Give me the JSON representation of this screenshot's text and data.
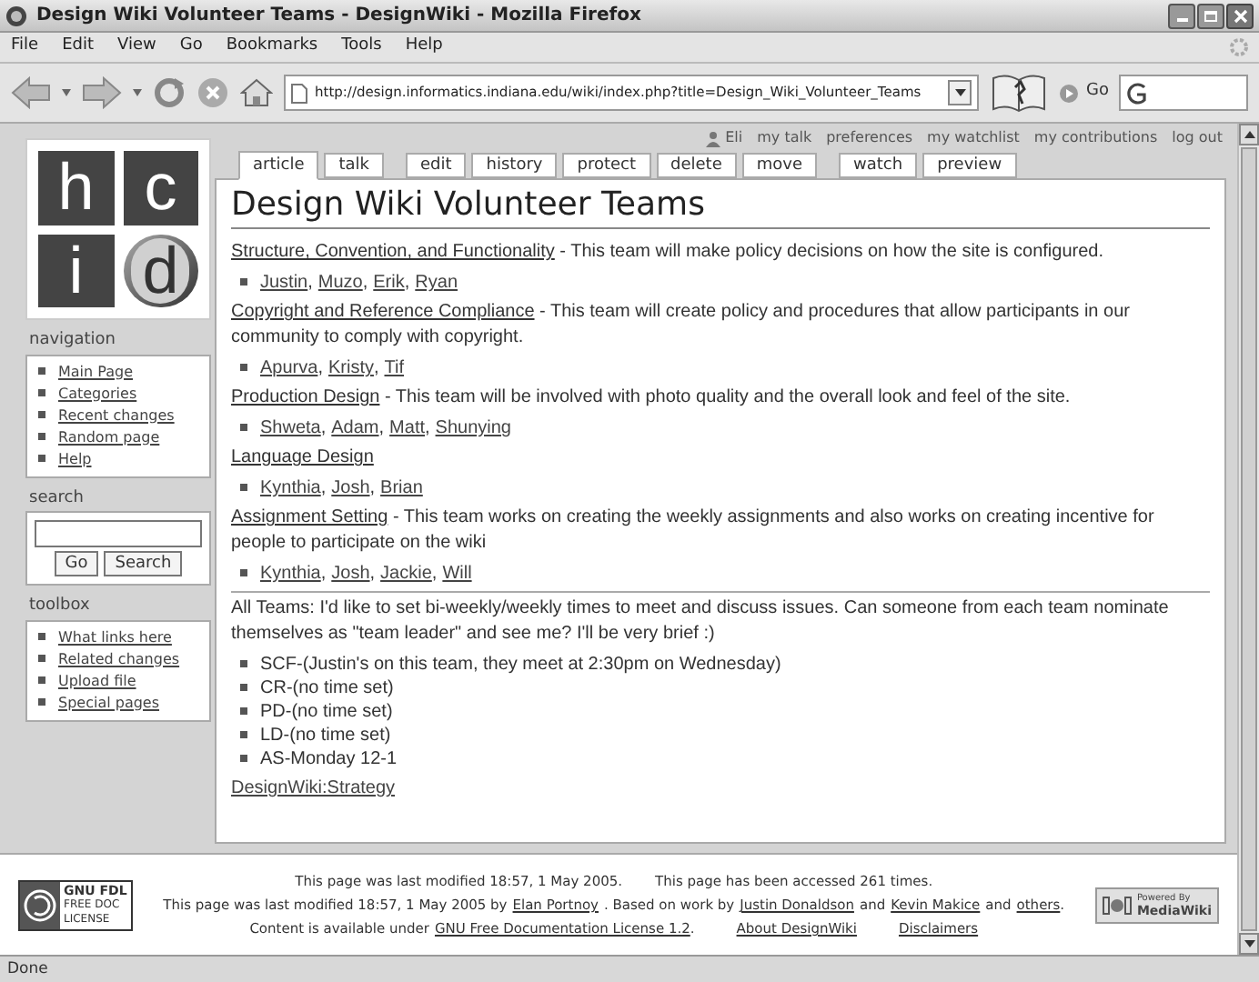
{
  "window": {
    "title": "Design Wiki Volunteer Teams - DesignWiki - Mozilla Firefox"
  },
  "menu": [
    "File",
    "Edit",
    "View",
    "Go",
    "Bookmarks",
    "Tools",
    "Help"
  ],
  "toolbar": {
    "url": "http://design.informatics.indiana.edu/wiki/index.php?title=Design_Wiki_Volunteer_Teams",
    "go_label": "Go"
  },
  "personal": {
    "user": "Eli",
    "links": [
      "my talk",
      "preferences",
      "my watchlist",
      "my contributions",
      "log out"
    ]
  },
  "tab_groups": [
    [
      {
        "label": "article",
        "selected": true
      },
      {
        "label": "talk",
        "selected": false
      }
    ],
    [
      {
        "label": "edit",
        "selected": false
      },
      {
        "label": "history",
        "selected": false
      },
      {
        "label": "protect",
        "selected": false
      },
      {
        "label": "delete",
        "selected": false
      },
      {
        "label": "move",
        "selected": false
      }
    ],
    [
      {
        "label": "watch",
        "selected": false
      },
      {
        "label": "preview",
        "selected": false
      }
    ]
  ],
  "logo": {
    "letters": [
      "h",
      "c",
      "i",
      "d"
    ]
  },
  "sidebar": {
    "navigation": {
      "label": "navigation",
      "items": [
        "Main Page",
        "Categories",
        "Recent changes",
        "Random page",
        "Help"
      ]
    },
    "search": {
      "label": "search",
      "buttons": [
        "Go",
        "Search"
      ]
    },
    "toolbox": {
      "label": "toolbox",
      "items": [
        "What links here",
        "Related changes",
        "Upload file",
        "Special pages"
      ]
    }
  },
  "heading": "Design Wiki Volunteer Teams",
  "member_separator": ",",
  "sections": [
    {
      "title": "Structure, Convention, and Functionality",
      "description": "- This team will make policy decisions on how the site is configured.",
      "members": [
        "Justin",
        "Muzo",
        "Erik",
        "Ryan"
      ]
    },
    {
      "title": "Copyright and Reference Compliance",
      "description": "- This team will create policy and procedures that allow participants in our community to comply with copyright.",
      "members": [
        "Apurva",
        "Kristy",
        "Tif"
      ]
    },
    {
      "title": "Production Design",
      "description": "- This team will be involved with photo quality and the overall look and feel of the site.",
      "members": [
        "Shweta",
        "Adam",
        "Matt",
        "Shunying"
      ]
    },
    {
      "title": "Language Design",
      "members": [
        "Kynthia",
        "Josh",
        "Brian"
      ]
    },
    {
      "title": "Assignment Setting",
      "description": "- This team works on creating the weekly assignments and also works on creating incentive for people to participate on the wiki",
      "members": [
        "Kynthia",
        "Josh",
        "Jackie",
        "Will"
      ]
    }
  ],
  "notice": "All Teams: I'd like to set bi-weekly/weekly times to meet and discuss issues. Can someone from each team nominate themselves as \"team leader\" and see me? I'll be very brief :)",
  "schedule": [
    "SCF-(Justin's on this team, they meet at 2:30pm on Wednesday)",
    "CR-(no time set)",
    "PD-(no time set)",
    "LD-(no time set)",
    "AS-Monday 12-1"
  ],
  "category_link": "DesignWiki:Strategy",
  "footer": {
    "badge_left": [
      "GNU FDL",
      "FREE DOC",
      "LICENSE"
    ],
    "badge_right": [
      "Powered By",
      "MediaWiki"
    ],
    "lines": [
      [
        {
          "kind": "text",
          "text": "This page was last modified 18:57, 1 May 2005."
        },
        {
          "kind": "text",
          "text": "This page has been accessed 261 times."
        }
      ],
      [
        {
          "kind": "text",
          "text": "This page was last modified 18:57, 1 May 2005 by"
        },
        {
          "kind": "link",
          "text": "Elan Portnoy"
        },
        {
          "kind": "text",
          "text": ". Based on work by"
        },
        {
          "kind": "link",
          "text": "Justin Donaldson"
        },
        {
          "kind": "text",
          "text": "and"
        },
        {
          "kind": "link",
          "text": "Kevin Makice"
        },
        {
          "kind": "text",
          "text": "and"
        },
        {
          "kind": "link",
          "text": "others"
        },
        {
          "kind": "text",
          "text": "."
        }
      ],
      [
        {
          "kind": "text",
          "text": "Content is available under"
        },
        {
          "kind": "link",
          "text": "GNU Free Documentation License 1.2"
        },
        {
          "kind": "text",
          "text": "."
        },
        {
          "kind": "link",
          "text": "About DesignWiki"
        },
        {
          "kind": "link",
          "text": "Disclaimers"
        }
      ]
    ]
  },
  "status_bar": "Done"
}
